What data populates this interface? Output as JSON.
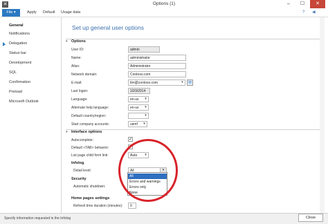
{
  "window": {
    "title": "Options (1)"
  },
  "menu": {
    "file": "File",
    "file_arrow": "▾",
    "items": [
      "Apply",
      "Default",
      "Usage data"
    ],
    "help": "?",
    "back": "◀"
  },
  "sidebar": {
    "items": [
      "General",
      "Notifications",
      "Delegation",
      "Status bar",
      "Development",
      "SQL",
      "Confirmation",
      "Preload",
      "Microsoft Outlook"
    ],
    "selected": "General"
  },
  "main": {
    "title": "Set up general user options",
    "options": {
      "title": "Options",
      "user_id_label": "User ID:",
      "user_id": "admin",
      "name_label": "Name:",
      "name": "administrator",
      "alias_label": "Alias:",
      "alias": "Administrator",
      "domain_label": "Network domain:",
      "domain": "Contoso.com",
      "email_label": "E-mail:",
      "email": "tim@contoso.com",
      "last_logon_label": "Last logon:",
      "last_logon": "10/3/2014",
      "language_label": "Language:",
      "language": "en-us",
      "alt_help_label": "Alternate help language:",
      "alt_help": "en-us",
      "country_label": "Default country/region:",
      "country": "",
      "company_label": "Start company accounts:",
      "company": "usmf"
    },
    "interface": {
      "title": "Interface options",
      "autocomplete_label": "Autocomplete:",
      "tab_label": "Default <TAB> behavior:",
      "list_link_label": "List page child form link:",
      "list_link": "Auto",
      "infolog_title": "Infolog",
      "detail_label": "Detail level:",
      "detail": "All",
      "dropdown_options": [
        "All",
        "Errors and warnings",
        "Errors only",
        "None"
      ],
      "security_title": "Security",
      "shutdown_label": "Automatic shutdown:",
      "home_title": "Home pages settings",
      "refresh_label": "Refresh time duration (minutes):",
      "refresh": "0"
    }
  },
  "status": {
    "text": "Specify information requested in the Infolog",
    "close": "Close"
  },
  "colors": {
    "accent": "#2b79c2",
    "highlight": "#d8222a"
  }
}
